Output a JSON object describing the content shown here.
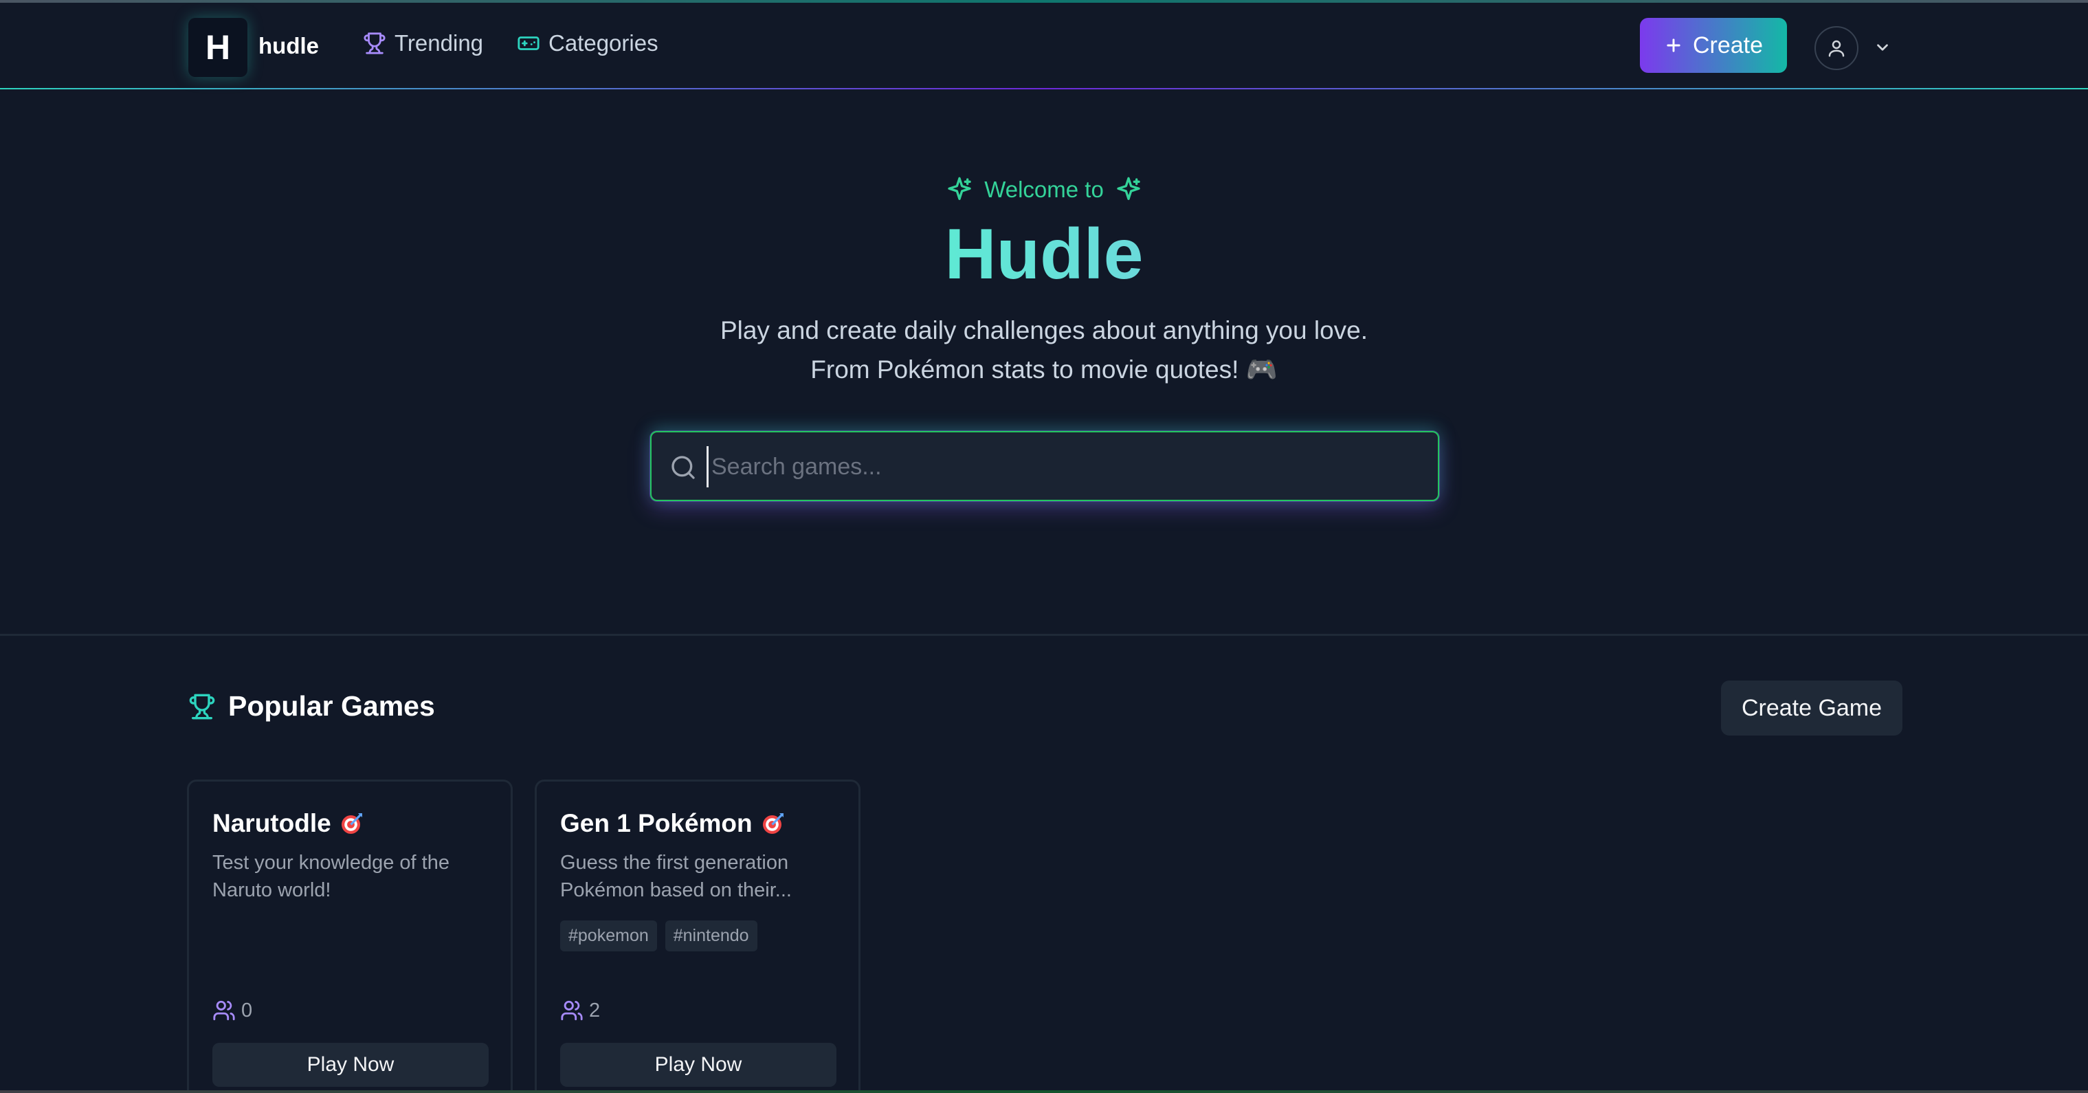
{
  "header": {
    "logo_letter": "H",
    "logo_text": "hudle",
    "nav": [
      {
        "label": "Trending",
        "icon": "trophy-icon"
      },
      {
        "label": "Categories",
        "icon": "gamepad-icon"
      }
    ],
    "create_label": "Create"
  },
  "hero": {
    "welcome": "Welcome to",
    "title": "Hudle",
    "subtitle_line1": "Play and create daily challenges about anything you love.",
    "subtitle_line2": "From Pokémon stats to movie quotes! 🎮"
  },
  "search": {
    "placeholder": "Search games...",
    "value": ""
  },
  "popular": {
    "heading": "Popular Games",
    "create_game_label": "Create Game",
    "games": [
      {
        "title": "Narutodle",
        "description": "Test your knowledge of the Naruto world!",
        "tags": [],
        "players": "0",
        "play_label": "Play Now"
      },
      {
        "title": "Gen 1 Pokémon",
        "description": "Guess the first generation Pokémon based on their...",
        "tags": [
          "#pokemon",
          "#nintendo"
        ],
        "players": "2",
        "play_label": "Play Now"
      }
    ]
  },
  "colors": {
    "background": "#111827",
    "accent_purple": "#7c3aed",
    "accent_teal": "#14b8a6",
    "welcome_green": "#34d399"
  }
}
